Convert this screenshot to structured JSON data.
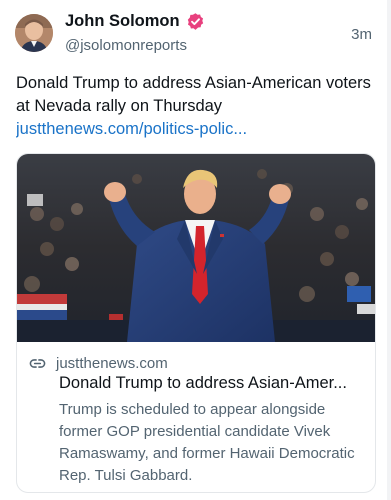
{
  "author": {
    "display_name": "John Solomon",
    "handle": "@jsolomonreports",
    "verified": true,
    "verified_color": "#e8407e"
  },
  "post": {
    "timestamp": "3m",
    "text": "Donald Trump to address Asian-American voters at Nevada rally on Thursday",
    "link": "justthenews.com/politics-polic..."
  },
  "card": {
    "domain": "justthenews.com",
    "title": "Donald Trump to address Asian-Amer...",
    "description": "Trump is scheduled to appear alongside former GOP presidential candidate Vivek Ramaswamy, and former Hawaii Democratic Rep. Tulsi Gabbard.",
    "icons": {
      "link": "link-icon"
    }
  },
  "colors": {
    "text": "#0f1419",
    "secondary": "#536471",
    "link": "#1a73c8",
    "border": "#e4e7ea"
  }
}
